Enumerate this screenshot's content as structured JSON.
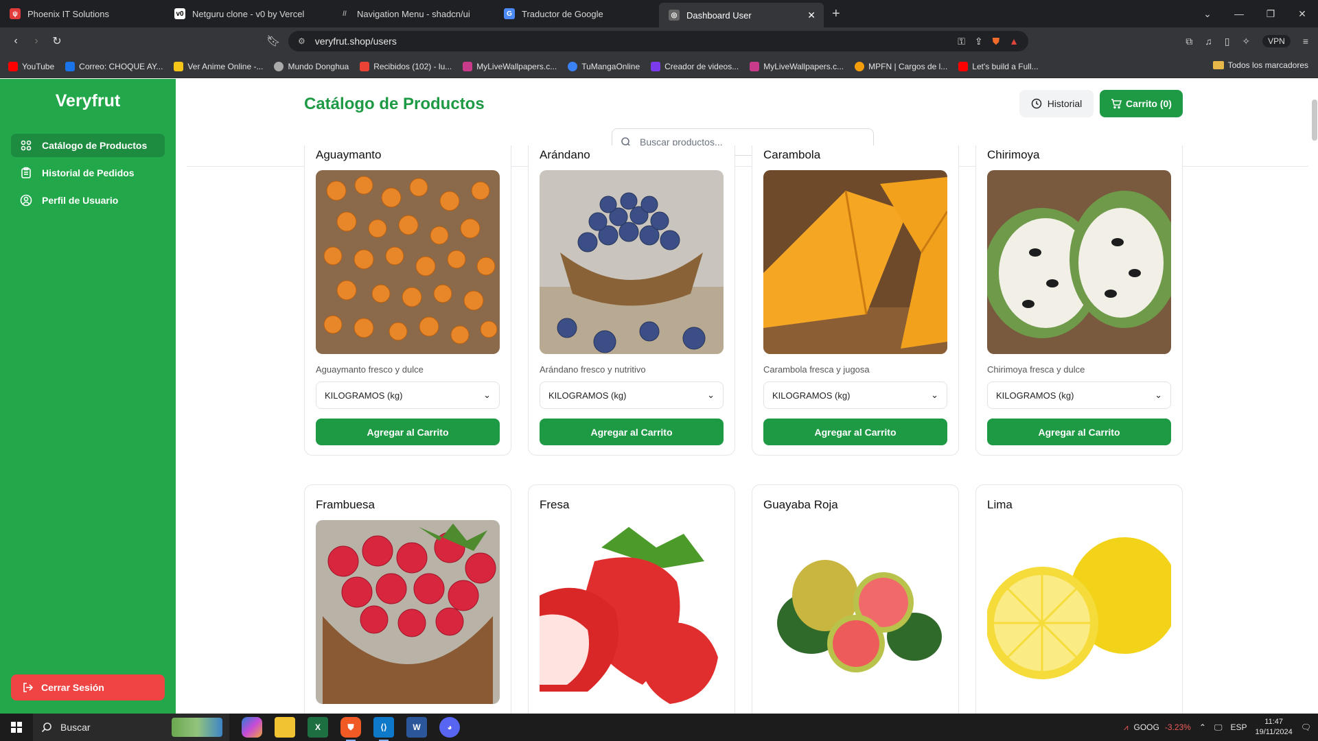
{
  "browser": {
    "tabs": [
      {
        "title": "Phoenix IT Solutions",
        "favicon_color": "#e23b3b",
        "active": false
      },
      {
        "title": "Netguru clone - v0 by Vercel",
        "favicon_color": "#ffffff",
        "active": false
      },
      {
        "title": "Navigation Menu - shadcn/ui",
        "favicon_color": "#555555",
        "active": false
      },
      {
        "title": "Traductor de Google",
        "favicon_color": "#4c8bf5",
        "active": false
      },
      {
        "title": "Dashboard User",
        "favicon_color": "#888888",
        "active": true
      }
    ],
    "new_tab": "+",
    "url": "veryfrut.shop/users",
    "vpn_label": "VPN",
    "bookmarks": [
      {
        "label": "YouTube",
        "color": "#ff0000"
      },
      {
        "label": "Correo: CHOQUE AY...",
        "color": "#1a73e8"
      },
      {
        "label": "Ver Anime Online -...",
        "color": "#f5c518"
      },
      {
        "label": "Mundo Donghua",
        "color": "#aaaaaa"
      },
      {
        "label": "Recibidos (102) - lu...",
        "color": "#ea4335"
      },
      {
        "label": "MyLiveWallpapers.c...",
        "color": "#c83a8a"
      },
      {
        "label": "TuMangaOnline",
        "color": "#3b82f6"
      },
      {
        "label": "Creador de videos...",
        "color": "#7c3aed"
      },
      {
        "label": "MyLiveWallpapers.c...",
        "color": "#c83a8a"
      },
      {
        "label": "MPFN | Cargos de l...",
        "color": "#f59e0b"
      },
      {
        "label": "Let's build a Full...",
        "color": "#ff0000"
      }
    ],
    "all_bookmarks": "Todos los marcadores"
  },
  "sidebar": {
    "brand": "Veryfrut",
    "items": [
      {
        "label": "Catálogo de Productos",
        "icon": "grid-fruit-icon",
        "active": true
      },
      {
        "label": "Historial de Pedidos",
        "icon": "clipboard-icon",
        "active": false
      },
      {
        "label": "Perfil de Usuario",
        "icon": "user-circle-icon",
        "active": false
      }
    ],
    "logout": "Cerrar Sesión"
  },
  "header": {
    "title": "Catálogo de Productos",
    "history_button": "Historial",
    "cart_button": "Carrito (0)"
  },
  "search": {
    "placeholder": "Buscar productos..."
  },
  "products": [
    {
      "name": "Aguaymanto",
      "description": "Aguaymanto fresco y dulce",
      "unit": "KILOGRAMOS (kg)",
      "add_label": "Agregar al Carrito"
    },
    {
      "name": "Arándano",
      "description": "Arándano fresco y nutritivo",
      "unit": "KILOGRAMOS (kg)",
      "add_label": "Agregar al Carrito"
    },
    {
      "name": "Carambola",
      "description": "Carambola fresca y jugosa",
      "unit": "KILOGRAMOS (kg)",
      "add_label": "Agregar al Carrito"
    },
    {
      "name": "Chirimoya",
      "description": "Chirimoya fresca y dulce",
      "unit": "KILOGRAMOS (kg)",
      "add_label": "Agregar al Carrito"
    },
    {
      "name": "Frambuesa"
    },
    {
      "name": "Fresa"
    },
    {
      "name": "Guayaba Roja"
    },
    {
      "name": "Lima"
    }
  ],
  "taskbar": {
    "search_label": "Buscar",
    "stock_symbol": "GOOG",
    "stock_change": "-3.23%",
    "language": "ESP",
    "time": "11:47",
    "date": "19/11/2024"
  }
}
